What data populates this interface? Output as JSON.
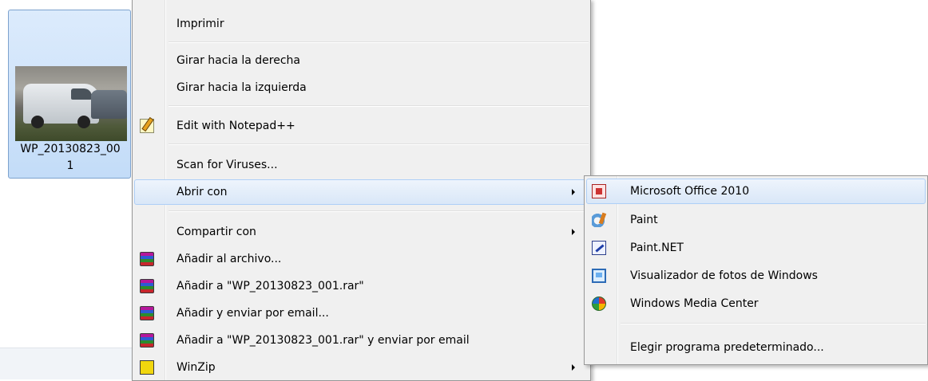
{
  "file": {
    "name": "WP_20130823_00\n1",
    "name_line1": "WP_20130823_00",
    "name_line2": "1"
  },
  "context_menu": {
    "items": [
      {
        "label": "Imprimir"
      },
      {
        "label": "Girar hacia la derecha"
      },
      {
        "label": "Girar hacia la izquierda"
      },
      {
        "label": "Edit with Notepad++",
        "icon": "notepad-plus-plus-icon"
      },
      {
        "label": "Scan for Viruses..."
      },
      {
        "label": "Abrir con",
        "submenu": true,
        "highlighted": true
      },
      {
        "label": "Compartir con",
        "submenu": true
      },
      {
        "label": "Añadir al archivo...",
        "icon": "winrar-icon"
      },
      {
        "label": "Añadir a \"WP_20130823_001.rar\"",
        "icon": "winrar-icon"
      },
      {
        "label": "Añadir y enviar por email...",
        "icon": "winrar-icon"
      },
      {
        "label": "Añadir a \"WP_20130823_001.rar\" y enviar por email",
        "icon": "winrar-icon"
      },
      {
        "label": "WinZip",
        "icon": "winzip-icon",
        "submenu": true
      }
    ]
  },
  "open_with_submenu": {
    "items": [
      {
        "label": "Microsoft Office 2010",
        "icon": "office-icon",
        "highlighted": true
      },
      {
        "label": "Paint",
        "icon": "paint-icon"
      },
      {
        "label": "Paint.NET",
        "icon": "paintnet-icon"
      },
      {
        "label": "Visualizador de fotos de Windows",
        "icon": "photo-viewer-icon"
      },
      {
        "label": "Windows Media Center",
        "icon": "media-center-icon"
      },
      {
        "label": "Elegir programa predeterminado..."
      }
    ]
  }
}
